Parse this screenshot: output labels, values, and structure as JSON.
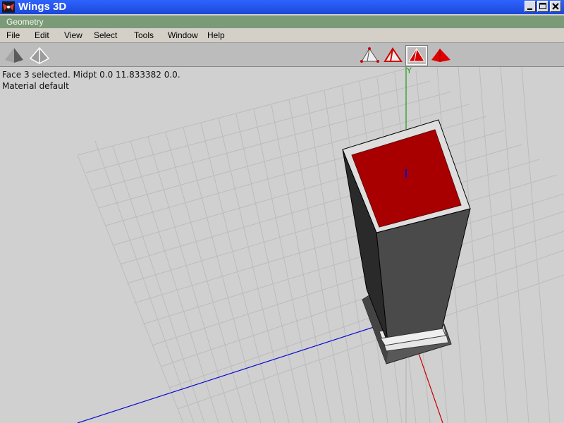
{
  "window": {
    "title": "Wings 3D"
  },
  "mode_bar": {
    "label": "Geometry"
  },
  "menu": {
    "items": [
      {
        "label": "File"
      },
      {
        "label": "Edit"
      },
      {
        "label": "View"
      },
      {
        "label": "Select"
      },
      {
        "label": "Tools"
      },
      {
        "label": "Window"
      },
      {
        "label": "Help"
      }
    ]
  },
  "toolbar": {
    "left_tools": [
      "smooth-shading-icon",
      "wireframe-shading-icon"
    ],
    "select_modes": [
      "vertex-mode-icon",
      "edge-mode-icon",
      "face-mode-icon",
      "body-mode-icon"
    ],
    "active_select_mode": "face"
  },
  "status": {
    "line1": "Face 3 selected. Midpt 0.0 11.833382 0.0.",
    "line2": "Material default"
  },
  "viewport": {
    "axis_label_y": "Y",
    "colors": {
      "axis_x": "#c80000",
      "axis_y": "#1a9c1a",
      "axis_z": "#0a0ad0",
      "selected_face": "#a80000",
      "grid": "#bdbdbd",
      "background": "#d0d0d0"
    }
  }
}
